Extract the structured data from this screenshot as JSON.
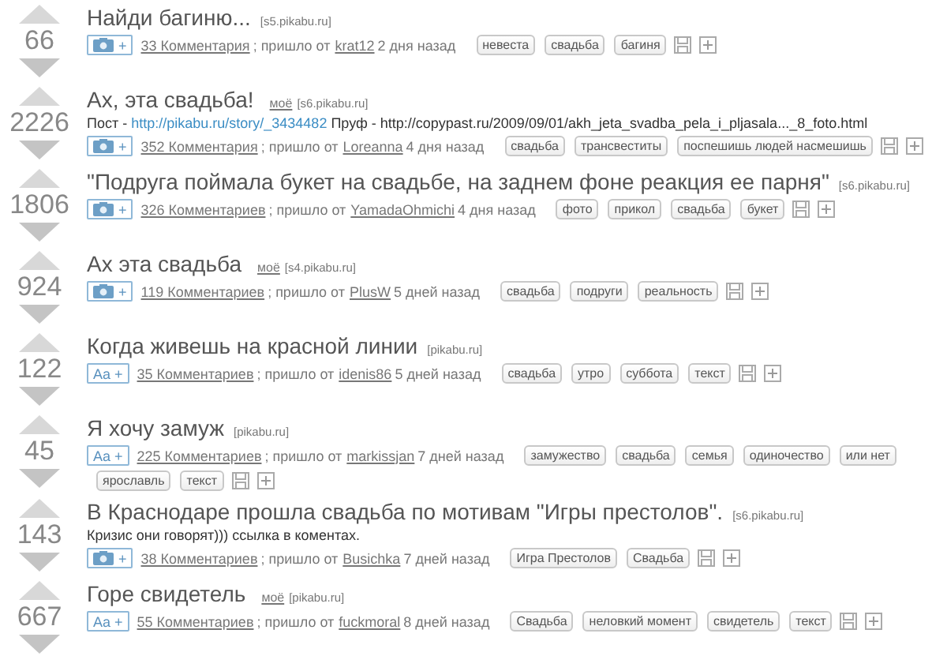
{
  "posts": [
    {
      "rating": "66",
      "title": "Найди багиню...",
      "source": "[s5.pikabu.ru]",
      "badge": {
        "kind": "photo",
        "text": "+"
      },
      "comments": "33 Комментария",
      "via": "; пришло от",
      "author": "krat12",
      "time": "2 дня назад",
      "tags": [
        "невеста",
        "свадьба",
        "багиня"
      ]
    },
    {
      "rating": "2226",
      "title": "Ах, эта свадьба!",
      "mine": "моё",
      "source": "[s6.pikabu.ru]",
      "description": [
        {
          "kind": "text",
          "text": "Пост - "
        },
        {
          "kind": "link",
          "text": "http://pikabu.ru/story/_3434482"
        },
        {
          "kind": "text",
          "text": " Пруф - http://copypast.ru/2009/09/01/akh_jeta_svadba_pela_i_pljasala..._8_foto.html"
        }
      ],
      "badge": {
        "kind": "photo",
        "text": "+"
      },
      "comments": "352 Комментария",
      "via": "; пришло от",
      "author": "Loreanna",
      "time": "4 дня назад",
      "tags": [
        "свадьба",
        "трансвеститы",
        "поспешишь людей насмешишь"
      ]
    },
    {
      "rating": "1806",
      "title": "\"Подруга поймала букет на свадьбе, на заднем фоне реакция ее парня\"",
      "source": "[s6.pikabu.ru]",
      "badge": {
        "kind": "photo",
        "text": "+"
      },
      "comments": "326 Комментариев",
      "via": "; пришло от",
      "author": "YamadaOhmichi",
      "time": "4 дня назад",
      "tags": [
        "фото",
        "прикол",
        "свадьба",
        "букет"
      ]
    },
    {
      "rating": "924",
      "title": "Ах эта свадьба",
      "mine": "моё",
      "source": "[s4.pikabu.ru]",
      "badge": {
        "kind": "photo",
        "text": "+"
      },
      "comments": "119 Комментариев",
      "via": "; пришло от",
      "author": "PlusW",
      "time": "5 дней назад",
      "tags": [
        "свадьба",
        "подруги",
        "реальность"
      ]
    },
    {
      "rating": "122",
      "title": "Когда живешь на красной линии",
      "source": "[pikabu.ru]",
      "badge": {
        "kind": "text",
        "text": "Aa +"
      },
      "comments": "35 Комментариев",
      "via": "; пришло от",
      "author": "idenis86",
      "time": "5 дней назад",
      "tags": [
        "свадьба",
        "утро",
        "суббота",
        "текст"
      ]
    },
    {
      "rating": "45",
      "title": "Я хочу замуж",
      "source": "[pikabu.ru]",
      "badge": {
        "kind": "text",
        "text": "Aa +"
      },
      "comments": "225 Комментариев",
      "via": "; пришло от",
      "author": "markissjan",
      "time": "7 дней назад",
      "tags": [
        "замужество",
        "свадьба",
        "семья",
        "одиночество",
        "или нет",
        "ярославль",
        "текст"
      ]
    },
    {
      "rating": "143",
      "title": "В Краснодаре прошла свадьба по мотивам \"Игры престолов\".",
      "source": "[s6.pikabu.ru]",
      "description": [
        {
          "kind": "text",
          "text": "Кризис они говорят))) ссылка в коментах."
        }
      ],
      "badge": {
        "kind": "photo",
        "text": "+"
      },
      "comments": "38 Комментариев",
      "via": "; пришло от",
      "author": "Busichka",
      "time": "7 дней назад",
      "tags": [
        "Игра Престолов",
        "Свадьба"
      ]
    },
    {
      "rating": "667",
      "title": "Горе свидетель",
      "mine": "моё",
      "source": "[pikabu.ru]",
      "badge": {
        "kind": "text",
        "text": "Aa +"
      },
      "comments": "55 Комментариев",
      "via": "; пришло от",
      "author": "fuckmoral",
      "time": "8 дней назад",
      "tags": [
        "Свадьба",
        "неловкий момент",
        "свидетель",
        "текст"
      ]
    }
  ]
}
